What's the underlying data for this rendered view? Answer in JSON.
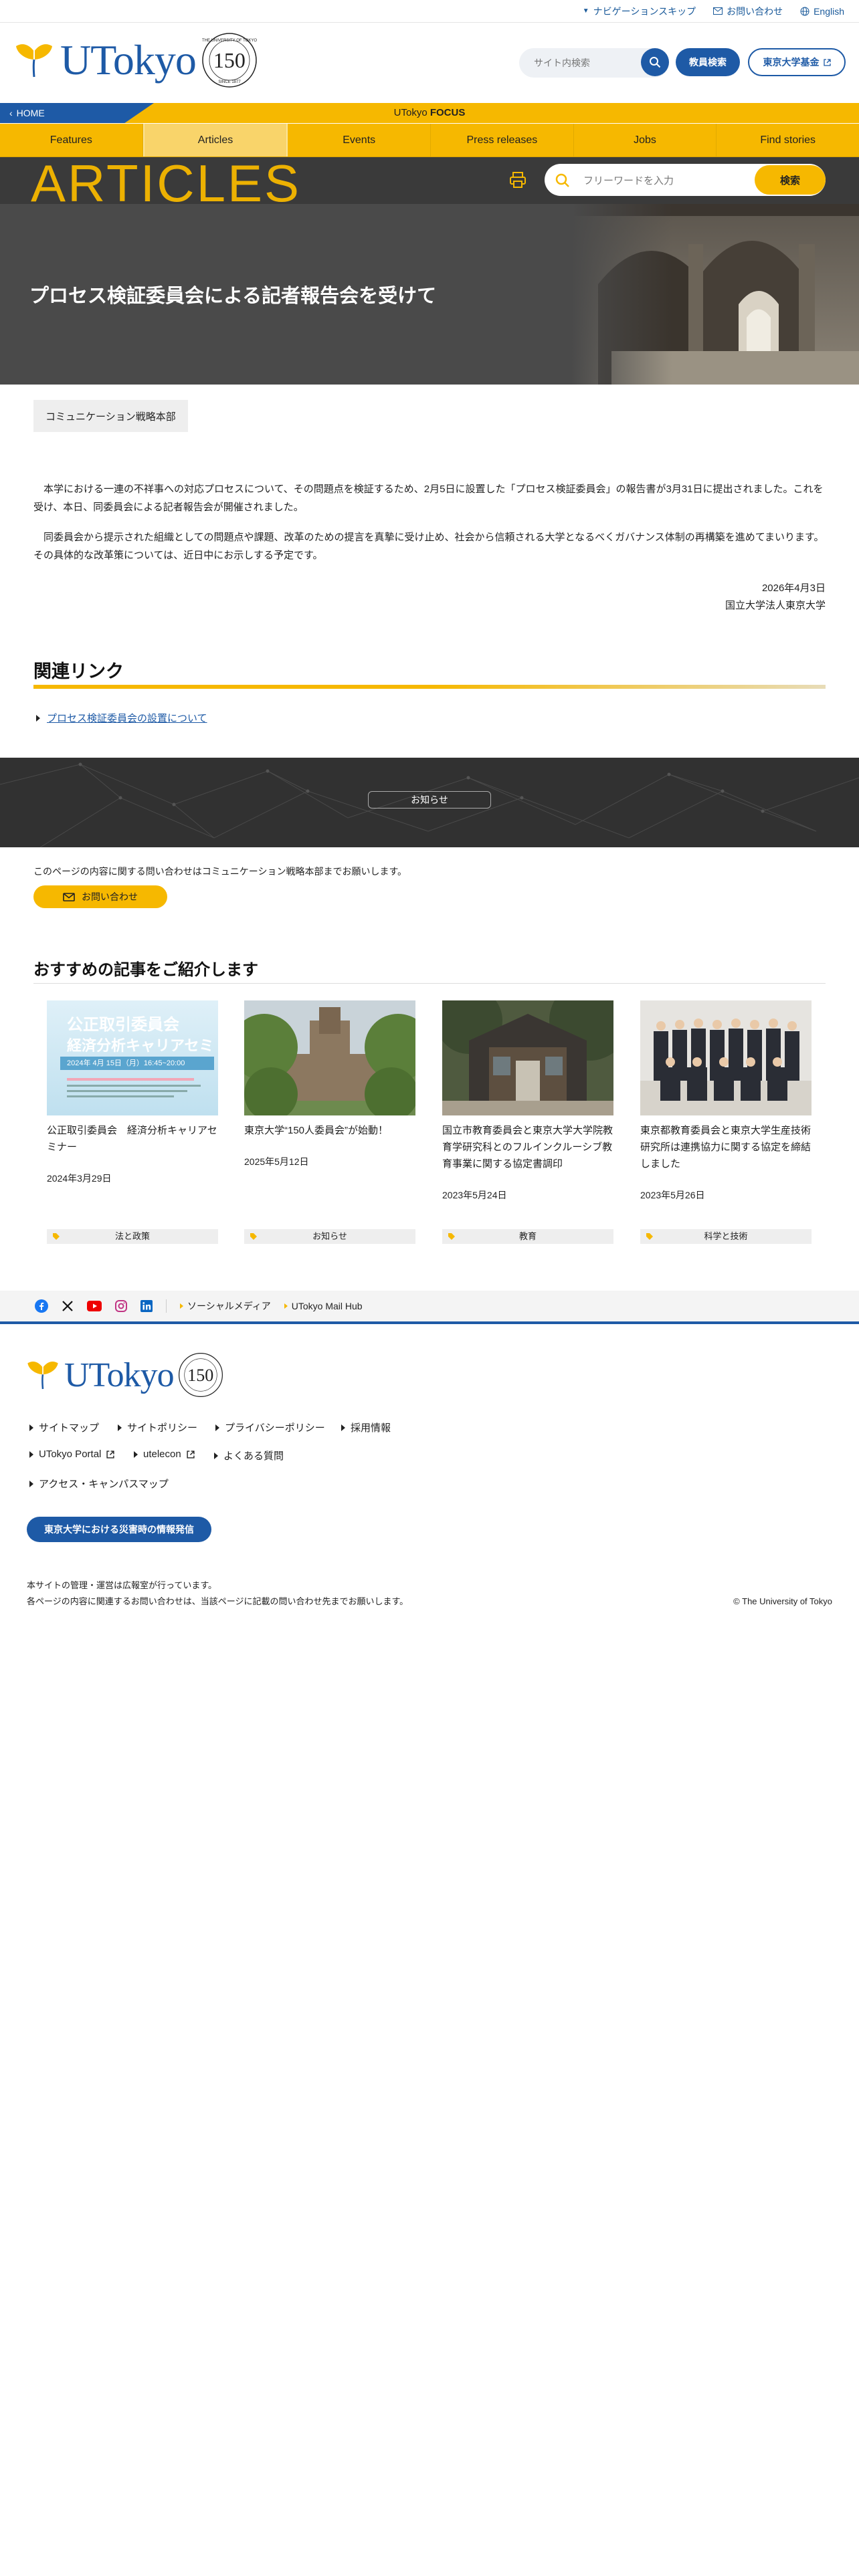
{
  "utility": {
    "skip": "ナビゲーションスキップ",
    "contact": "お問い合わせ",
    "english": "English"
  },
  "header": {
    "logo_text": "UTokyo",
    "anniv_number": "150",
    "search_placeholder": "サイト内検索",
    "faculty_search": "教員検索",
    "fund": "東京大学基金"
  },
  "strip": {
    "home": "HOME",
    "focus_prefix": "UTokyo ",
    "focus_bold": "FOCUS"
  },
  "nav": {
    "tabs": [
      {
        "label": "Features"
      },
      {
        "label": "Articles"
      },
      {
        "label": "Events"
      },
      {
        "label": "Press releases"
      },
      {
        "label": "Jobs"
      },
      {
        "label": "Find stories"
      }
    ]
  },
  "articles": {
    "heading": "ARTICLES",
    "search_placeholder": "フリーワードを入力",
    "search_button": "検索"
  },
  "hero": {
    "title": "プロセス検証委員会による記者報告会を受けて"
  },
  "article": {
    "tag": "コミュニケーション戦略本部",
    "para1": "　本学における一連の不祥事への対応プロセスについて、その問題点を検証するため、2月5日に設置した「プロセス検証委員会」の報告書が3月31日に提出されました。これを受け、本日、同委員会による記者報告会が開催されました。",
    "para2": "　同委員会から提示された組織としての問題点や課題、改革のための提言を真摯に受け止め、社会から信頼される大学となるべくガバナンス体制の再構築を進めてまいります。その具体的な改革策については、近日中にお示しする予定です。",
    "date": "2026年4月3日",
    "signature": "国立大学法人東京大学"
  },
  "related": {
    "heading": "関連リンク",
    "link": "プロセス検証委員会の設置について"
  },
  "notice": {
    "button": "お知らせ"
  },
  "contact": {
    "text": "このページの内容に関する問い合わせはコミュニケーション戦略本部までお願いします。",
    "button": "お問い合わせ"
  },
  "recommended": {
    "heading": "おすすめの記事をご紹介します",
    "cards": [
      {
        "title": "公正取引委員会　経済分析キャリアセミナー",
        "date": "2024年3月29日",
        "category": "法と政策",
        "img_title": "公正取引委員会",
        "img_sub": "経済分析キャリアセミ",
        "img_date": "2024年 4月 15日（月）16:45~20:00"
      },
      {
        "title": "東京大学“150人委員会”が始動！",
        "date": "2025年5月12日",
        "category": "お知らせ"
      },
      {
        "title": "国立市教育委員会と東京大学大学院教育学研究科とのフルインクルーシブ教育事業に関する協定書調印",
        "date": "2023年5月24日",
        "category": "教育"
      },
      {
        "title": "東京都教育委員会と東京大学生産技術研究所は連携協力に関する協定を締結しました",
        "date": "2023年5月26日",
        "category": "科学と技術"
      }
    ]
  },
  "social": {
    "icons": [
      "facebook-icon",
      "x-icon",
      "youtube-icon",
      "instagram-icon",
      "linkedin-icon"
    ],
    "media": "ソーシャルメディア",
    "mailhub": "UTokyo Mail Hub"
  },
  "footer": {
    "logo_text": "UTokyo",
    "anniv_number": "150",
    "links": {
      "sitemap": "サイトマップ",
      "sitepolicy": "サイトポリシー",
      "privacy": "プライバシーポリシー",
      "recruit": "採用情報",
      "portal": "UTokyo Portal",
      "utelecon": "utelecon",
      "faq": "よくある質問",
      "access": "アクセス・キャンパスマップ"
    },
    "disaster": "東京大学における災害時の情報発信",
    "note1": "本サイトの管理・運営は広報室が行っています。",
    "note2": "各ページの内容に関連するお問い合わせは、当該ページに記載の問い合わせ先までお願いします。",
    "copyright": "© The University of Tokyo"
  },
  "colors": {
    "brand_blue": "#1e5aa6",
    "brand_yellow": "#f6b800",
    "dark_band": "#313131"
  }
}
